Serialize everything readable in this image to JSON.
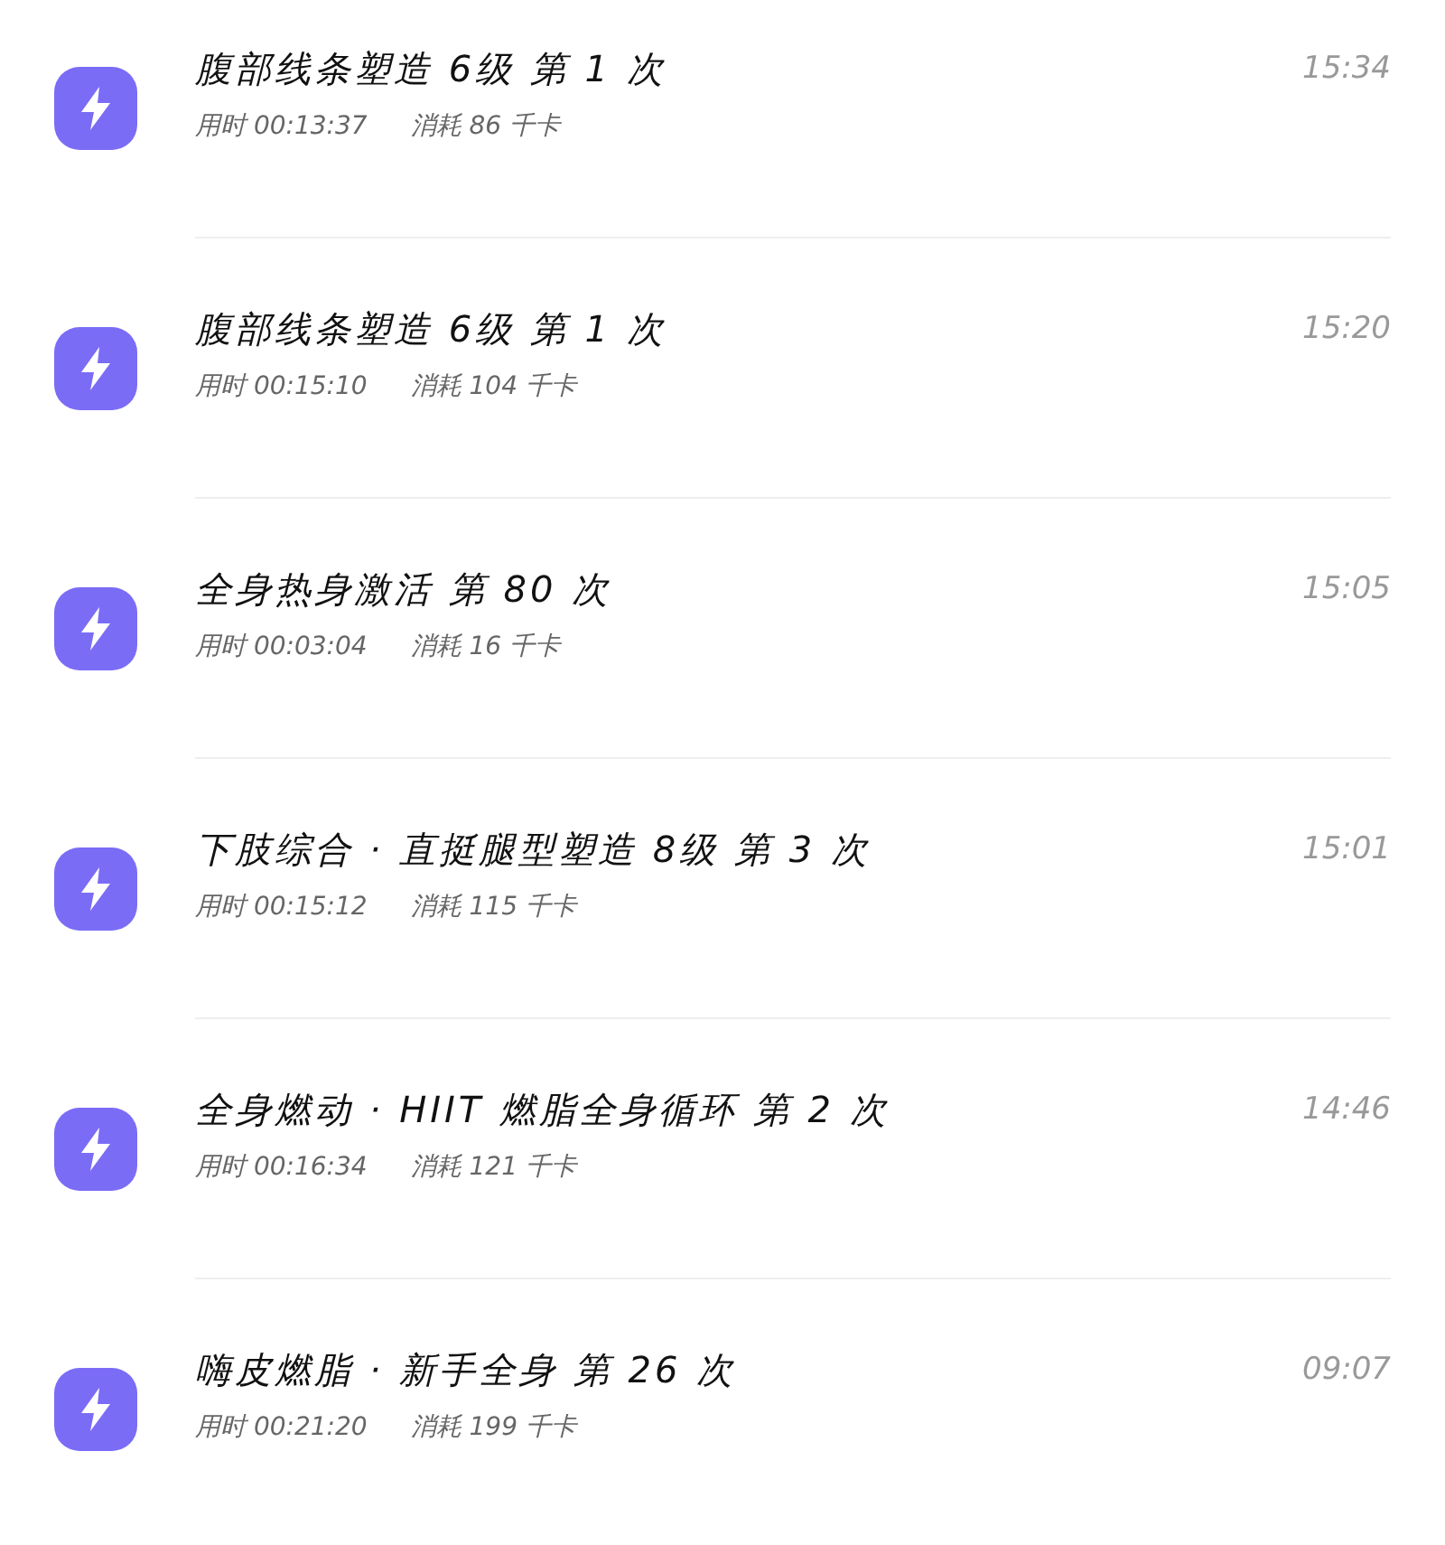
{
  "records": [
    {
      "title": "腹部线条塑造 6级 第 1 次",
      "duration": "用时 00:13:37",
      "calories": "消耗 86 千卡",
      "time": "15:34"
    },
    {
      "title": "腹部线条塑造 6级 第 1 次",
      "duration": "用时 00:15:10",
      "calories": "消耗 104 千卡",
      "time": "15:20"
    },
    {
      "title": "全身热身激活 第 80 次",
      "duration": "用时 00:03:04",
      "calories": "消耗 16 千卡",
      "time": "15:05"
    },
    {
      "title": "下肢综合 · 直挺腿型塑造 8级 第 3 次",
      "duration": "用时 00:15:12",
      "calories": "消耗 115 千卡",
      "time": "15:01"
    },
    {
      "title": "全身燃动 · HIIT 燃脂全身循环 第 2 次",
      "duration": "用时 00:16:34",
      "calories": "消耗 121 千卡",
      "time": "14:46"
    },
    {
      "title": "嗨皮燃脂 · 新手全身 第 26 次",
      "duration": "用时 00:21:20",
      "calories": "消耗 199 千卡",
      "time": "09:07"
    }
  ]
}
